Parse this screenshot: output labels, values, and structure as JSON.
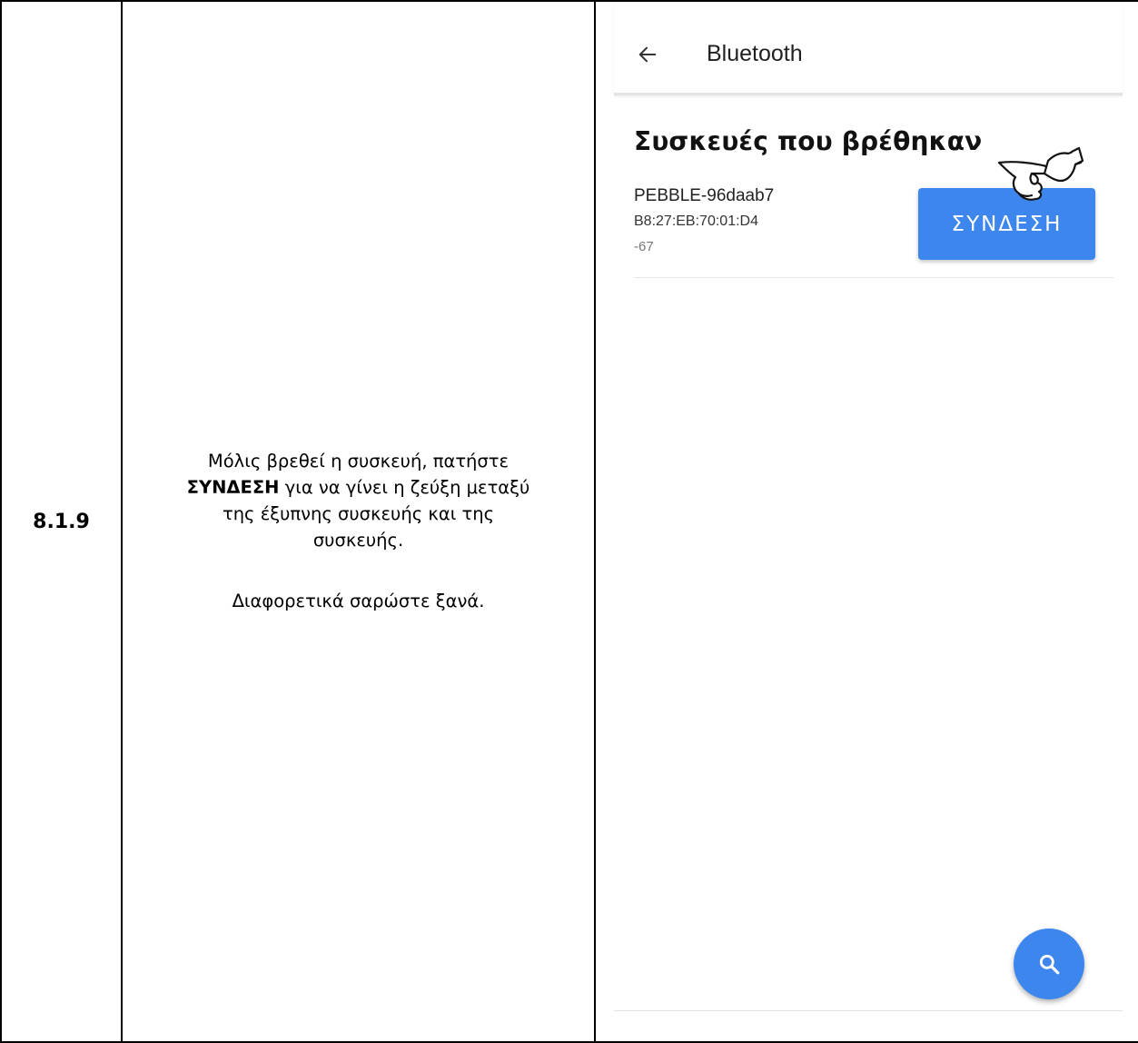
{
  "step": {
    "number": "8.1.9"
  },
  "instructions": {
    "line1": "Μόλις βρεθεί η συσκευή, πατήστε",
    "emphasis": "ΣΥΝΔΕΣΗ",
    "line2_rest": " για να γίνει η ζεύξη μεταξύ",
    "line3": "της έξυπνης συσκευής και της",
    "line4": "συσκευής.",
    "line5": "Διαφορετικά σαρώστε ξανά."
  },
  "screenshot": {
    "app_bar": {
      "back_icon": "arrow-left-icon",
      "title": "Bluetooth"
    },
    "section_heading": "Συσκευές που βρέθηκαν",
    "device": {
      "name": "PEBBLE-96daab7",
      "mac": "B8:27:EB:70:01:D4",
      "rssi": "-67",
      "connect_label": "ΣΥΝΔΕΣΗ"
    },
    "pointer_icon": "pointing-hand-icon",
    "fab_icon": "search-icon",
    "colors": {
      "accent": "#3d86ee",
      "text_primary": "#212121",
      "divider": "#e4e4e4"
    }
  }
}
